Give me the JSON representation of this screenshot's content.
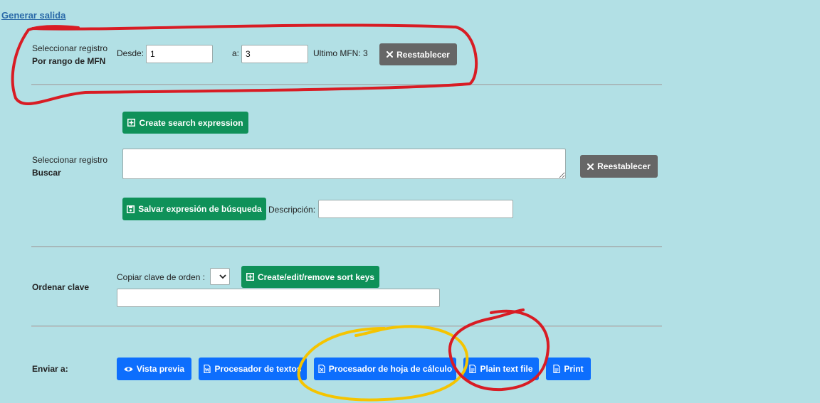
{
  "header": {
    "title": "Generar salida"
  },
  "range": {
    "label_line1": "Seleccionar registro",
    "label_line2": "Por rango de MFN",
    "desde_label": "Desde:",
    "desde_value": "1",
    "a_label": "a:",
    "a_value": "3",
    "ultimo": "Ultimo MFN: 3",
    "reset_label": "Reestablecer"
  },
  "search": {
    "create_label": "Create search expression",
    "label_line1": "Seleccionar registro",
    "label_line2": "Buscar",
    "textarea_value": "",
    "reset_label": "Reestablecer",
    "save_label": "Salvar expresión de búsqueda",
    "descripcion_label": "Descripción:",
    "descripcion_value": ""
  },
  "sort": {
    "label": "Ordenar clave",
    "copy_label": "Copiar clave de orden :",
    "select_value": "",
    "keys_button": "Create/edit/remove sort keys",
    "keys_value": ""
  },
  "send": {
    "label": "Enviar a:",
    "buttons": [
      {
        "label": "Vista previa",
        "icon": "eye-icon"
      },
      {
        "label": "Procesador de textos",
        "icon": "word-file-icon"
      },
      {
        "label": "Procesador de hoja de cálculo",
        "icon": "excel-file-icon"
      },
      {
        "label": "Plain text file",
        "icon": "text-file-icon"
      },
      {
        "label": "Print",
        "icon": "print-file-icon"
      }
    ]
  },
  "annotations": {
    "red_color": "#d81c24",
    "yellow_color": "#f5c400"
  }
}
